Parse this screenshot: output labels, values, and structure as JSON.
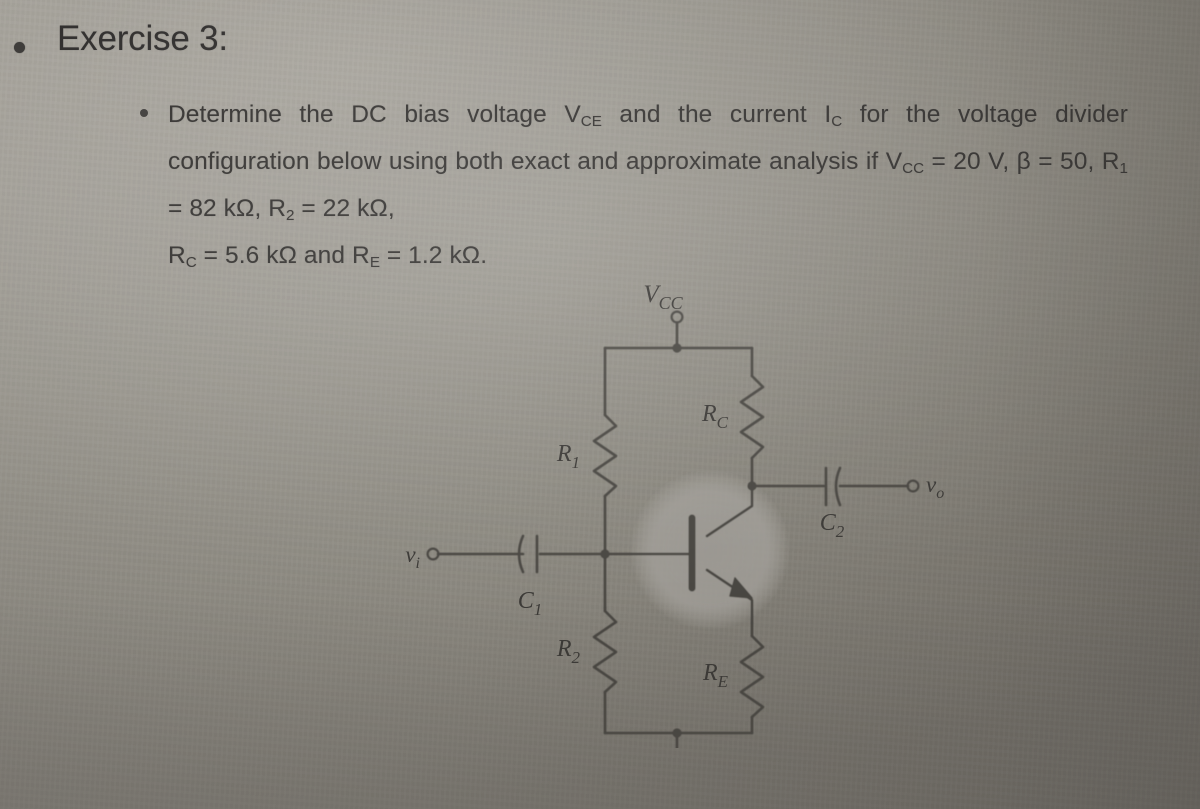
{
  "page": {
    "background_color": "#bdbab5",
    "ink_color": "#33312f",
    "medium": "photographed printed page"
  },
  "heading": {
    "bullet": "•",
    "title": "Exercise 3:"
  },
  "problem": {
    "bullet": "•",
    "line1_a": "Determine the DC bias voltage V",
    "line1_sub1": "CE",
    "line1_b": " and the current I",
    "line1_sub2": "C",
    "line1_c": " for the",
    "line2": "voltage divider configuration below using both exact and",
    "line3_a": "approximate analysis if V",
    "line3_sub1": "CC",
    "line3_b": " = 20 V, β = 50, R",
    "line3_sub2": "1",
    "line3_c": " = 82 kΩ, R",
    "line3_sub3": "2",
    "line3_d": " = 22 kΩ,",
    "line4_a": "R",
    "line4_sub1": "C",
    "line4_b": " = 5.6 kΩ and R",
    "line4_sub2": "E",
    "line4_c": " = 1.2 kΩ."
  },
  "given_values": {
    "VCC": "20 V",
    "beta": "50",
    "R1": "82 kΩ",
    "R2": "22 kΩ",
    "RC": "5.6 kΩ",
    "RE": "1.2 kΩ"
  },
  "unknowns": [
    "VCE",
    "IC"
  ],
  "circuit": {
    "type": "voltage-divider-bias-BJT-amplifier",
    "supply_label": "V",
    "supply_sub": "CC",
    "input_label": "v",
    "input_sub": "i",
    "output_label": "v",
    "output_sub": "o",
    "components": [
      {
        "name": "R1",
        "label": "R",
        "sub": "1",
        "kind": "resistor"
      },
      {
        "name": "R2",
        "label": "R",
        "sub": "2",
        "kind": "resistor"
      },
      {
        "name": "RC",
        "label": "R",
        "sub": "C",
        "kind": "resistor"
      },
      {
        "name": "RE",
        "label": "R",
        "sub": "E",
        "kind": "resistor"
      },
      {
        "name": "C1",
        "label": "C",
        "sub": "1",
        "kind": "capacitor"
      },
      {
        "name": "C2",
        "label": "C",
        "sub": "2",
        "kind": "capacitor"
      },
      {
        "name": "Q1",
        "label": "",
        "sub": "",
        "kind": "npn-transistor"
      },
      {
        "name": "GND",
        "label": "",
        "sub": "",
        "kind": "ground"
      }
    ],
    "colors": {
      "wire": "#46443f",
      "transistor_halo": "#9b9892"
    }
  },
  "watermark": {
    "text": ""
  }
}
